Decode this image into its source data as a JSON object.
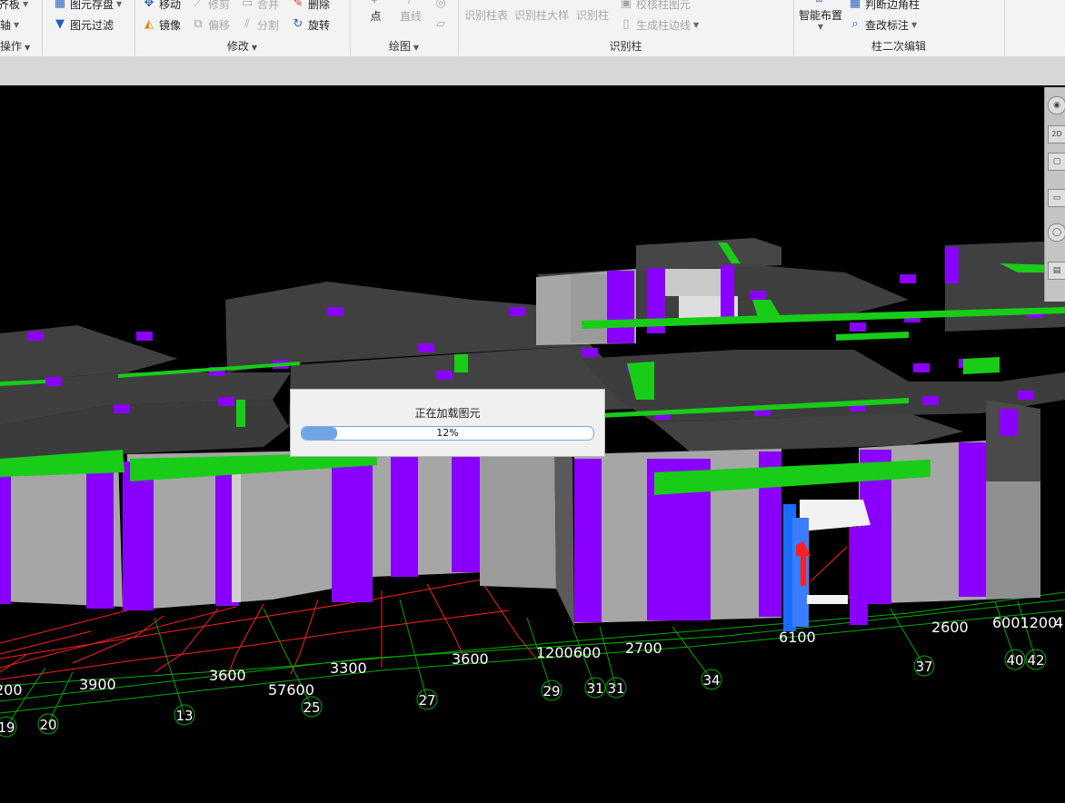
{
  "ribbon": {
    "group1": {
      "items": [
        "齐板",
        "轴",
        "操作"
      ],
      "dropdowns": [
        true,
        true,
        true
      ]
    },
    "group2": {
      "items": [
        {
          "label": "图元存盘",
          "icon": "save-element-icon",
          "enabled": true
        },
        {
          "label": "图元过滤",
          "icon": "filter-icon",
          "enabled": true
        }
      ]
    },
    "modify": {
      "title": "修改",
      "items": [
        {
          "label": "移动",
          "icon": "move-icon",
          "enabled": true
        },
        {
          "label": "修剪",
          "icon": "trim-icon",
          "enabled": false
        },
        {
          "label": "合并",
          "icon": "merge-icon",
          "enabled": false
        },
        {
          "label": "删除",
          "icon": "delete-icon",
          "enabled": true
        },
        {
          "label": "镜像",
          "icon": "mirror-icon",
          "enabled": true
        },
        {
          "label": "偏移",
          "icon": "offset-icon",
          "enabled": false
        },
        {
          "label": "分割",
          "icon": "split-icon",
          "enabled": false
        },
        {
          "label": "旋转",
          "icon": "rotate-icon",
          "enabled": true
        }
      ]
    },
    "draw": {
      "title": "绘图",
      "items": [
        {
          "label": "点",
          "icon": "point-icon",
          "enabled": true
        },
        {
          "label": "直线",
          "icon": "line-icon",
          "enabled": false
        }
      ]
    },
    "identify": {
      "title": "识别柱",
      "items": [
        {
          "label": "识别柱表",
          "enabled": false
        },
        {
          "label": "识别柱大样",
          "enabled": false
        },
        {
          "label": "识别柱",
          "enabled": false
        },
        {
          "label": "校核柱图元",
          "icon": "check-column-icon",
          "enabled": false
        },
        {
          "label": "生成柱边线",
          "icon": "generate-edge-icon",
          "enabled": false
        }
      ]
    },
    "secondary": {
      "title": "柱二次编辑",
      "items": [
        {
          "label": "智能布置",
          "icon": "smart-layout-icon",
          "enabled": true
        },
        {
          "label": "判断边角柱",
          "icon": "corner-column-icon",
          "enabled": true
        },
        {
          "label": "查改标注",
          "icon": "edit-annotation-icon",
          "enabled": true
        }
      ]
    }
  },
  "navbar": {
    "scale_label": "2D"
  },
  "dialog": {
    "title": "正在加载图元",
    "progress_percent": 12,
    "progress_text": "12%"
  },
  "dimensions": [
    "200",
    "3900",
    "3600",
    "57600",
    "3300",
    "3600",
    "1200600",
    "2700",
    "6100",
    "2600",
    "6001200",
    "4"
  ],
  "axis_labels": [
    "19",
    "20",
    "13",
    "25",
    "27",
    "29",
    "31",
    "31",
    "34",
    "37",
    "40",
    "42"
  ],
  "colors": {
    "slab": "#404040",
    "wall": "#a6a6a6",
    "column": "#8a00ff",
    "beam": "#18cc18",
    "selected_column": "#1a6cff",
    "grid_axis": "#00aa00",
    "grid_red": "#ff2020",
    "dim_text": "#ffffff",
    "progress_fill": "#6fa4e6"
  }
}
